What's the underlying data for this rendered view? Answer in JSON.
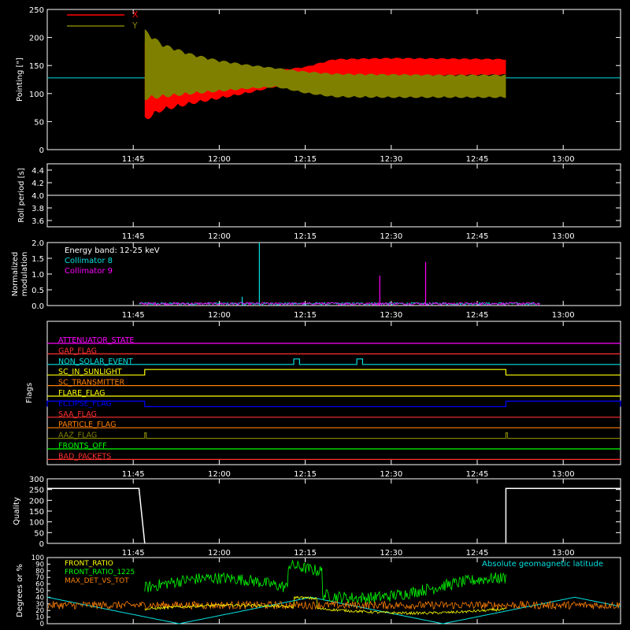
{
  "colors": {
    "background": "#000000",
    "axis": "#ffffff",
    "x_pointing": "#ff0000",
    "y_pointing": "#808000",
    "collimator8": "#00e0e0",
    "collimator9": "#ff00ff",
    "front_ratio": "#ffff00",
    "front_ratio_1225": "#00ff00",
    "max_det": "#ff8000",
    "geolat": "#00e0e0"
  },
  "chart_data": [
    {
      "type": "area",
      "ylabel": "Pointing [\"]",
      "x_range": [
        "11:30",
        "13:10"
      ],
      "xticks": [
        "11:45",
        "12:00",
        "12:15",
        "12:30",
        "12:45",
        "13:00"
      ],
      "ylim": [
        0,
        250
      ],
      "yticks": [
        "0",
        "50",
        "100",
        "150",
        "200",
        "250"
      ],
      "baseline": 128,
      "legend": "top-left",
      "series": [
        {
          "name": "X",
          "x": [
            "11:47",
            "11:50",
            "11:55",
            "12:00",
            "12:05",
            "12:10",
            "12:15",
            "12:20",
            "12:30",
            "12:40",
            "12:50"
          ],
          "low": [
            50,
            68,
            80,
            90,
            100,
            112,
            122,
            128,
            130,
            132,
            133
          ],
          "high": [
            200,
            180,
            165,
            155,
            148,
            142,
            148,
            162,
            164,
            163,
            162
          ]
        },
        {
          "name": "Y",
          "x": [
            "11:47",
            "11:50",
            "11:55",
            "12:00",
            "12:05",
            "12:10",
            "12:15",
            "12:20",
            "12:30",
            "12:40",
            "12:50"
          ],
          "low": [
            88,
            92,
            98,
            103,
            108,
            111,
            100,
            93,
            92,
            92,
            92
          ],
          "high": [
            215,
            190,
            172,
            160,
            152,
            146,
            140,
            136,
            135,
            134,
            134
          ]
        }
      ]
    },
    {
      "type": "line",
      "ylabel": "Roll period [s]",
      "ylim": [
        3.5,
        4.5
      ],
      "yticks": [
        "3.6",
        "3.8",
        "4.0",
        "4.2",
        "4.4"
      ],
      "x": [
        "11:30",
        "13:10"
      ],
      "values": [
        4.0,
        4.0
      ]
    },
    {
      "type": "line",
      "ylabel": "Normalized modulation",
      "ylim": [
        0,
        2.0
      ],
      "yticks": [
        "0.0",
        "0.5",
        "1.0",
        "1.5",
        "2.0"
      ],
      "legend": "top-left",
      "annotation": "Energy band: 12-25 keV",
      "series": [
        {
          "name": "Collimator 8",
          "spikes": [
            {
              "x": "12:07",
              "y": 2.0
            },
            {
              "x": "12:04",
              "y": 0.28
            }
          ]
        },
        {
          "name": "Collimator 9",
          "spikes": [
            {
              "x": "12:28",
              "y": 0.95
            },
            {
              "x": "12:36",
              "y": 1.38
            }
          ]
        }
      ],
      "x_range": [
        "11:46",
        "12:56"
      ]
    },
    {
      "type": "line",
      "ylabel": "Flags",
      "flags": [
        {
          "name": "ATTENUATOR_STATE",
          "color": "#ff00ff"
        },
        {
          "name": "GAP_FLAG",
          "color": "#ff3030"
        },
        {
          "name": "NON_SOLAR_EVENT",
          "color": "#00e0e0",
          "pulses": [
            [
              "12:13",
              "12:14"
            ],
            [
              "12:24",
              "12:25"
            ]
          ]
        },
        {
          "name": "SC_IN_SUNLIGHT",
          "color": "#ffff00",
          "pulses": [
            [
              "11:47",
              "12:50"
            ]
          ]
        },
        {
          "name": "SC_TRANSMITTER",
          "color": "#ff8000"
        },
        {
          "name": "FLARE_FLAG",
          "color": "#ffff00"
        },
        {
          "name": "ECLIPSE_FLAG",
          "color": "#0000ff",
          "pulses": [
            [
              "11:30",
              "11:47"
            ],
            [
              "12:50",
              "13:10"
            ]
          ]
        },
        {
          "name": "SAA_FLAG",
          "color": "#ff3030"
        },
        {
          "name": "PARTICLE_FLAG",
          "color": "#ff8000"
        },
        {
          "name": "AAZ_FLAG",
          "color": "#808000",
          "pulses": [
            [
              "11:47",
              "11:47"
            ],
            [
              "12:50",
              "12:50"
            ]
          ]
        },
        {
          "name": "FRONTS_OFF",
          "color": "#00ff00"
        },
        {
          "name": "BAD_PACKETS",
          "color": "#ff3030"
        }
      ]
    },
    {
      "type": "line",
      "ylabel": "Quality",
      "ylim": [
        0,
        300
      ],
      "yticks": [
        "0",
        "50",
        "100",
        "150",
        "200",
        "250",
        "300"
      ],
      "segments": [
        {
          "x": [
            "11:30",
            "11:46",
            "11:47"
          ],
          "values": [
            255,
            255,
            0
          ]
        },
        {
          "x": [
            "12:50",
            "12:50",
            "13:10"
          ],
          "values": [
            0,
            255,
            255
          ]
        }
      ]
    },
    {
      "type": "line",
      "ylabel": "Degrees or %",
      "ylim": [
        0,
        100
      ],
      "yticks": [
        "0",
        "10",
        "20",
        "30",
        "40",
        "50",
        "60",
        "70",
        "80",
        "90",
        "100"
      ],
      "legend": "top-left",
      "annotation": "Absolute geomagnetic latitude",
      "series": [
        {
          "name": "FRONT_RATIO",
          "approx": "low ~20-30 with hump near 12:15"
        },
        {
          "name": "FRONT_RATIO_1225",
          "approx": "~40-60, peak ~85 near 12:15"
        },
        {
          "name": "MAX_DET_VS_TOT",
          "approx": "~20-30 noisy"
        }
      ]
    }
  ]
}
